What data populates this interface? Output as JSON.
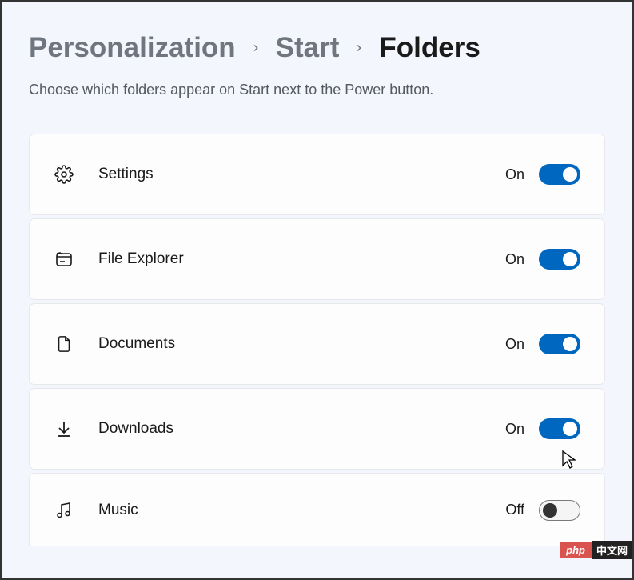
{
  "breadcrumb": {
    "level1": "Personalization",
    "level2": "Start",
    "level3": "Folders"
  },
  "subtitle": "Choose which folders appear on Start next to the Power button.",
  "state_labels": {
    "on": "On",
    "off": "Off"
  },
  "rows": [
    {
      "icon": "gear-icon",
      "label": "Settings",
      "state": "On",
      "on": true
    },
    {
      "icon": "file-explorer-icon",
      "label": "File Explorer",
      "state": "On",
      "on": true
    },
    {
      "icon": "document-icon",
      "label": "Documents",
      "state": "On",
      "on": true
    },
    {
      "icon": "download-icon",
      "label": "Downloads",
      "state": "On",
      "on": true
    },
    {
      "icon": "music-icon",
      "label": "Music",
      "state": "Off",
      "on": false
    }
  ],
  "watermark": {
    "left": "php",
    "right": "中文网"
  },
  "colors": {
    "accent": "#0067c0",
    "background": "#f3f6fc"
  }
}
